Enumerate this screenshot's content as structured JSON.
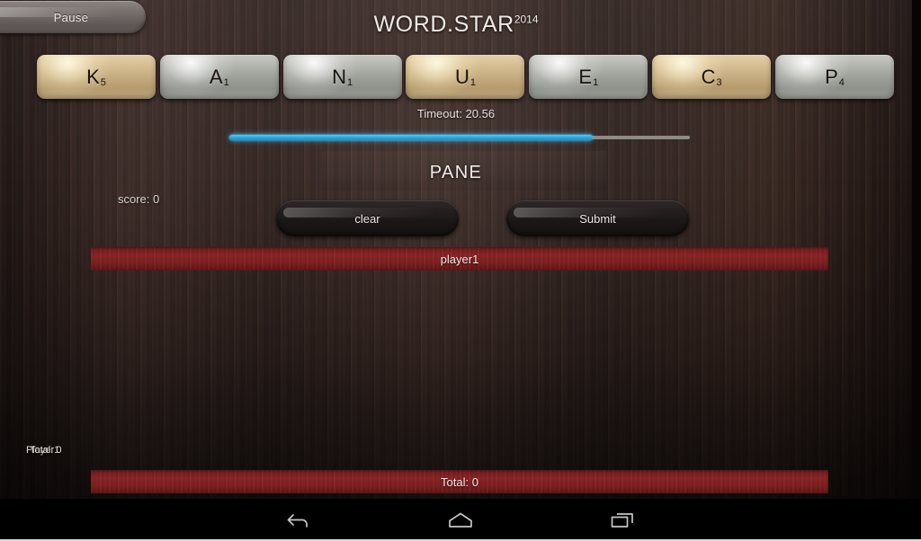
{
  "app": {
    "title": "WORD.STAR",
    "title_superscript": "2014"
  },
  "controls": {
    "pause_label": "Pause",
    "clear_label": "clear",
    "submit_label": "Submit"
  },
  "rack": {
    "tiles": [
      {
        "letter": "K",
        "value": "5",
        "style": "gold"
      },
      {
        "letter": "A",
        "value": "1",
        "style": "silver"
      },
      {
        "letter": "N",
        "value": "1",
        "style": "silver"
      },
      {
        "letter": "U",
        "value": "1",
        "style": "gold"
      },
      {
        "letter": "E",
        "value": "1",
        "style": "silver"
      },
      {
        "letter": "C",
        "value": "3",
        "style": "gold"
      },
      {
        "letter": "P",
        "value": "4",
        "style": "silver"
      }
    ]
  },
  "timer": {
    "label": "Timeout: 20.56",
    "progress_percent": 79
  },
  "word": {
    "current": "PANE"
  },
  "score": {
    "label": "score: 0"
  },
  "bars": {
    "player_label": "player1",
    "total_label": "Total: 0"
  },
  "overlap": {
    "label_a": "Player1",
    "label_b": "Total: 0"
  },
  "navbar": {
    "back_label": "Back",
    "home_label": "Home",
    "recents_label": "Recent apps"
  },
  "colors": {
    "progress_fill": "#2aa3dc",
    "progress_track": "#8e8b86",
    "red_bar": "#7e1d1d",
    "tile_gold": "#c2a87c",
    "tile_silver": "#9a9d96",
    "surface": "#2e211e"
  }
}
